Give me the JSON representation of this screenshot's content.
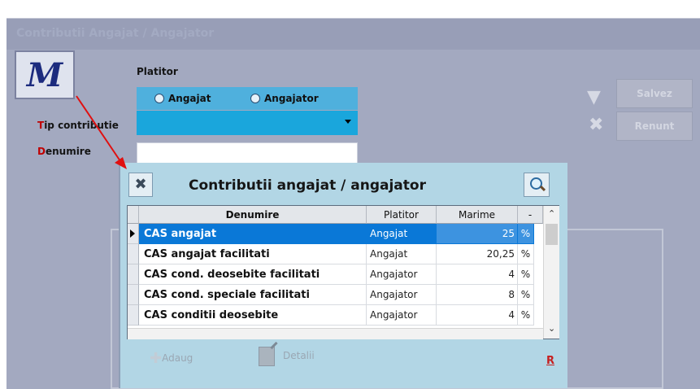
{
  "window": {
    "title": "Contributii Angajat / Angajator"
  },
  "logo": {
    "letter": "M"
  },
  "form": {
    "platitor_label": "Platitor",
    "radio_angajat": "Angajat",
    "radio_angajator": "Angajator",
    "tip_first": "T",
    "tip_rest": "ip contributie",
    "den_first": "D",
    "den_rest": "enumire",
    "tip_value": "",
    "den_value": ""
  },
  "actions": {
    "save_label": "Salvez",
    "cancel_label": "Renunt"
  },
  "popup": {
    "title": "Contributii angajat / angajator",
    "columns": [
      "Denumire",
      "Platitor",
      "Marime",
      "-"
    ],
    "rows": [
      {
        "denumire": "CAS angajat",
        "platitor": "Angajat",
        "marime": "25",
        "unit": "%",
        "selected": true
      },
      {
        "denumire": "CAS angajat facilitati",
        "platitor": "Angajat",
        "marime": "20,25",
        "unit": "%"
      },
      {
        "denumire": "CAS cond. deosebite facilitati",
        "platitor": "Angajator",
        "marime": "4",
        "unit": "%"
      },
      {
        "denumire": "CAS cond. speciale facilitati",
        "platitor": "Angajator",
        "marime": "8",
        "unit": "%"
      },
      {
        "denumire": "CAS conditii deosebite",
        "platitor": "Angajator",
        "marime": "4",
        "unit": "%"
      }
    ],
    "add_label": "Adaug",
    "details_label": "Detalii",
    "r_label": "R"
  },
  "colors": {
    "selected_row": "#0a78d7",
    "accent_blue": "#1aa6dc",
    "required_red": "#c00000"
  }
}
